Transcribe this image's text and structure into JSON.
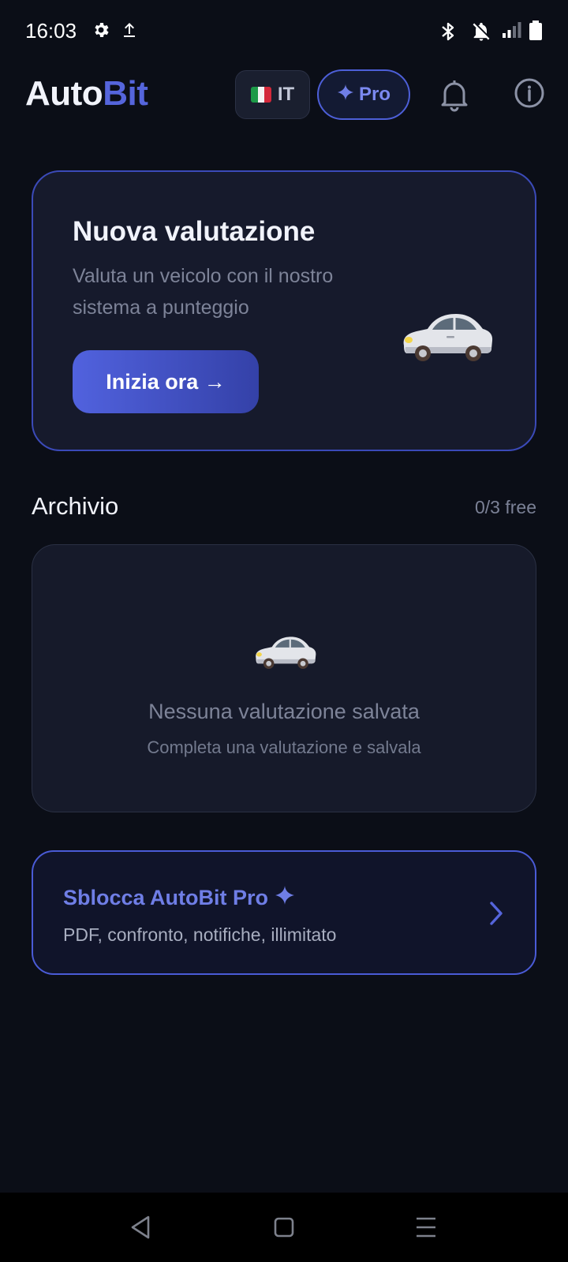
{
  "status": {
    "time": "16:03",
    "left_icons": [
      "gear-icon",
      "upload-icon"
    ],
    "right_icons": [
      "bluetooth-icon",
      "notifications-off-icon",
      "signal-icon",
      "battery-icon"
    ]
  },
  "header": {
    "logo_part1": "Auto",
    "logo_part2": "Bit",
    "language": "IT",
    "flag": "flag-italy-icon",
    "pro_label": "Pro",
    "icons": [
      "bell-icon",
      "info-icon"
    ]
  },
  "evaluation": {
    "title": "Nuova valutazione",
    "subtitle": "Valuta un veicolo con il nostro sistema a punteggio",
    "button": "Inizia ora →",
    "illustration": "car-icon"
  },
  "archive": {
    "title": "Archivio",
    "count": "0/3 free",
    "empty_title": "Nessuna valutazione salvata",
    "empty_subtitle": "Completa una valutazione e salvala"
  },
  "pro_card": {
    "title": "Sblocca AutoBit Pro",
    "subtitle": "PDF, confronto, notifiche, illimitato"
  },
  "nav": {
    "icons": [
      "back-icon",
      "home-icon",
      "menu-icon"
    ]
  },
  "colors": {
    "background": "#0b0e17",
    "accent": "#5565dc",
    "card": "#161a2c"
  }
}
